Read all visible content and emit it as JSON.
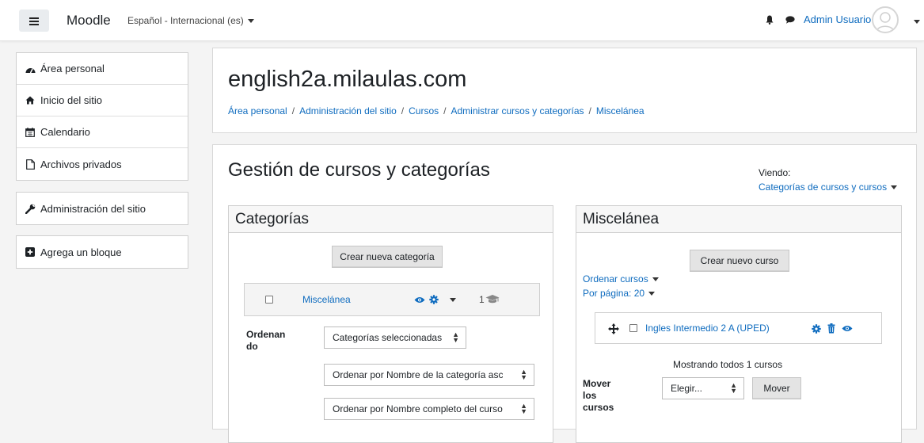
{
  "navbar": {
    "brand": "Moodle",
    "language": "Español - Internacional (es)",
    "user_name": "Admin Usuario"
  },
  "sidebar": {
    "nav_items": [
      {
        "label": "Área personal",
        "icon": "dashboard-icon"
      },
      {
        "label": "Inicio del sitio",
        "icon": "home-icon"
      },
      {
        "label": "Calendario",
        "icon": "calendar-icon"
      },
      {
        "label": "Archivos privados",
        "icon": "file-icon"
      }
    ],
    "admin_item": {
      "label": "Administración del sitio",
      "icon": "wrench-icon"
    },
    "add_block": {
      "label": "Agrega un bloque",
      "icon": "plus-square-icon"
    }
  },
  "header": {
    "site_title": "english2a.milaulas.com",
    "breadcrumb": [
      "Área personal",
      "Administración del sitio",
      "Cursos",
      "Administrar cursos y categorías",
      "Miscelánea"
    ]
  },
  "main": {
    "heading": "Gestión de cursos y categorías",
    "viewing_label": "Viendo:",
    "viewing_value": "Categorías de cursos y cursos"
  },
  "categories_panel": {
    "title": "Categorías",
    "create_button": "Crear nueva categoría",
    "category": {
      "name": "Miscelánea",
      "course_count": "1"
    },
    "sorting_label": "Ordenando",
    "sorting_label_line1": "Ordenan",
    "sorting_label_line2": "do",
    "sort_scope": "Categorías seleccionadas",
    "sort_by_category": "Ordenar por Nombre de la categoría asc",
    "sort_by_course": "Ordenar por Nombre completo del curso"
  },
  "courses_panel": {
    "title": "Miscelánea",
    "create_button": "Crear nuevo curso",
    "sort_courses": "Ordenar cursos",
    "per_page": "Por página: 20",
    "course": {
      "name": "Ingles Intermedio 2 A (UPED)"
    },
    "showing": "Mostrando todos 1 cursos",
    "move_label_line1": "Mover",
    "move_label_line2": "los",
    "move_label_line3": "cursos",
    "move_select": "Elegir...",
    "move_button": "Mover"
  },
  "colors": {
    "link": "#0f6cbf",
    "page_bg": "#f4f4f4",
    "panel_head": "#f7f7f7"
  }
}
